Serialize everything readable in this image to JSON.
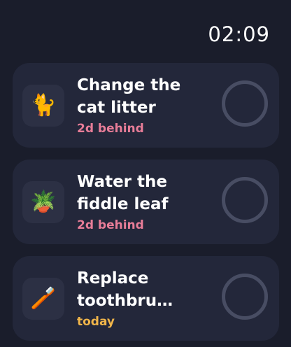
{
  "status_bar": {
    "time": "02:09"
  },
  "tasks": [
    {
      "emoji": "🐈",
      "icon_name": "cat-icon",
      "title": "Change the\ncat litter",
      "status": "2d behind",
      "status_color": "#e87d98"
    },
    {
      "emoji": "🪴",
      "icon_name": "potted-plant-icon",
      "title": "Water the\nfiddle leaf",
      "status": "2d behind",
      "status_color": "#e87d98"
    },
    {
      "emoji": "🪥",
      "icon_name": "toothbrush-icon",
      "title": "Replace\ntoothbru…",
      "status": "today",
      "status_color": "#f0b54a"
    }
  ],
  "colors": {
    "background": "#1a1d2b",
    "card": "#23273a",
    "ring": "#484d63"
  }
}
